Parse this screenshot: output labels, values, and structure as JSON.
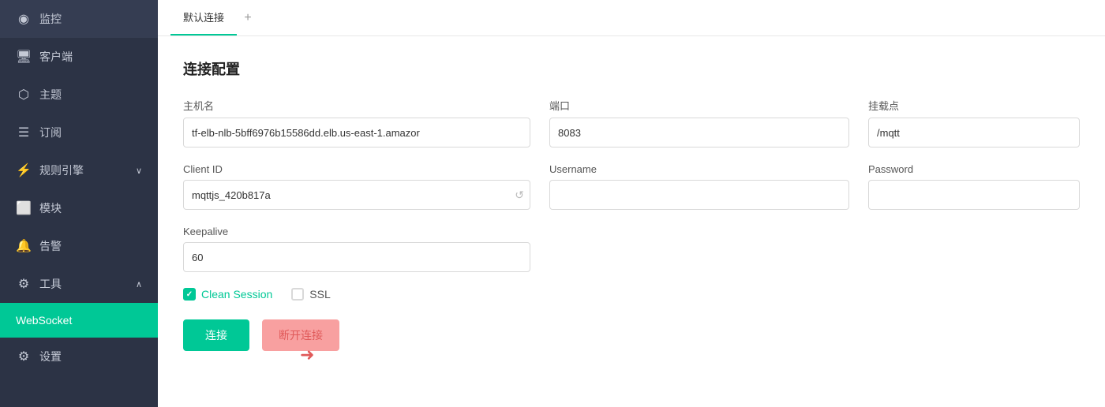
{
  "sidebar": {
    "items": [
      {
        "id": "monitor",
        "label": "监控",
        "icon": "📊",
        "active": false
      },
      {
        "id": "client",
        "label": "客户端",
        "icon": "🖥",
        "active": false
      },
      {
        "id": "topic",
        "label": "主题",
        "icon": "📦",
        "active": false
      },
      {
        "id": "subscribe",
        "label": "订阅",
        "icon": "📋",
        "active": false
      },
      {
        "id": "rules",
        "label": "规则引擎",
        "icon": "⚙",
        "active": false,
        "hasChevron": true,
        "chevronUp": false
      },
      {
        "id": "modules",
        "label": "模块",
        "icon": "🧩",
        "active": false
      },
      {
        "id": "alerts",
        "label": "告警",
        "icon": "🔔",
        "active": false
      },
      {
        "id": "tools",
        "label": "工具",
        "icon": "🔧",
        "active": false,
        "hasChevron": true,
        "chevronUp": true
      },
      {
        "id": "websocket",
        "label": "WebSocket",
        "icon": "",
        "active": true
      },
      {
        "id": "settings",
        "label": "设置",
        "icon": "⚙",
        "active": false
      }
    ]
  },
  "tabs": {
    "active_tab": "默认连接",
    "tabs": [
      {
        "id": "default-conn",
        "label": "默认连接"
      }
    ],
    "add_label": "+"
  },
  "form": {
    "title": "连接配置",
    "host": {
      "label": "主机名",
      "value": "tf-elb-nlb-5bff6976b15586dd.elb.us-east-1.amazor",
      "placeholder": ""
    },
    "port": {
      "label": "端口",
      "value": "8083",
      "placeholder": ""
    },
    "mount": {
      "label": "挂载点",
      "value": "/mqtt",
      "placeholder": ""
    },
    "clientid": {
      "label": "Client ID",
      "value": "mqttjs_420b817a",
      "placeholder": "",
      "clearable": true
    },
    "username": {
      "label": "Username",
      "value": "",
      "placeholder": ""
    },
    "password": {
      "label": "Password",
      "value": "",
      "placeholder": ""
    },
    "keepalive": {
      "label": "Keepalive",
      "value": "60",
      "placeholder": ""
    },
    "clean_session": {
      "label": "Clean Session",
      "checked": true
    },
    "ssl": {
      "label": "SSL",
      "checked": false
    }
  },
  "buttons": {
    "connect": "连接",
    "disconnect": "断开连接"
  }
}
